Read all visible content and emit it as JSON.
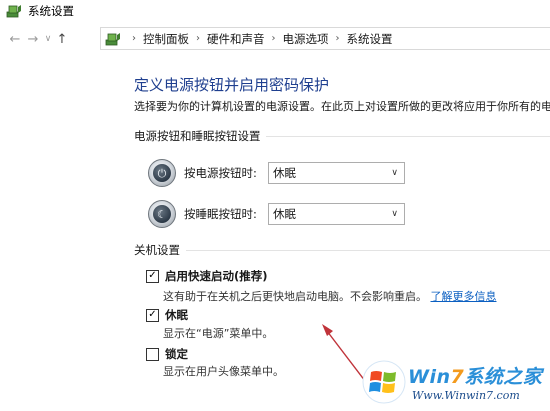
{
  "window": {
    "title": "系统设置",
    "app_icon": "power-options-icon"
  },
  "navigation": {
    "back_icon": "arrow-left-icon",
    "forward_icon": "arrow-right-icon",
    "recent_icon": "chevron-down-icon",
    "up_icon": "arrow-up-icon",
    "breadcrumb": [
      "控制面板",
      "硬件和声音",
      "电源选项",
      "系统设置"
    ]
  },
  "page": {
    "heading": "定义电源按钮并启用密码保护",
    "description": "选择要为你的计算机设置的电源设置。在此页上对设置所做的更改将应用于你所有的电"
  },
  "power_buttons": {
    "section_title": "电源按钮和睡眠按钮设置",
    "rows": [
      {
        "icon": "power-button-icon",
        "label": "按电源按钮时:",
        "value": "休眠"
      },
      {
        "icon": "sleep-button-icon",
        "label": "按睡眠按钮时:",
        "value": "休眠"
      }
    ]
  },
  "shutdown": {
    "section_title": "关机设置",
    "items": [
      {
        "label": "启用快速启动(推荐)",
        "checked": true,
        "desc": "这有助于在关机之后更快地启动电脑。不会影响重启。",
        "link": "了解更多信息"
      },
      {
        "label": "休眠",
        "checked": true,
        "desc": "显示在“电源”菜单中。"
      },
      {
        "label": "锁定",
        "checked": false,
        "desc": "显示在用户头像菜单中。"
      }
    ]
  },
  "watermark": {
    "brand_prefix": "Win",
    "brand_seven": "7",
    "brand_suffix": "系统之家",
    "url": "Www.Winwin7.com"
  },
  "colors": {
    "heading": "#1f3f8f",
    "link": "#0b5fc1",
    "annotation_arrow": "#c0333a"
  }
}
